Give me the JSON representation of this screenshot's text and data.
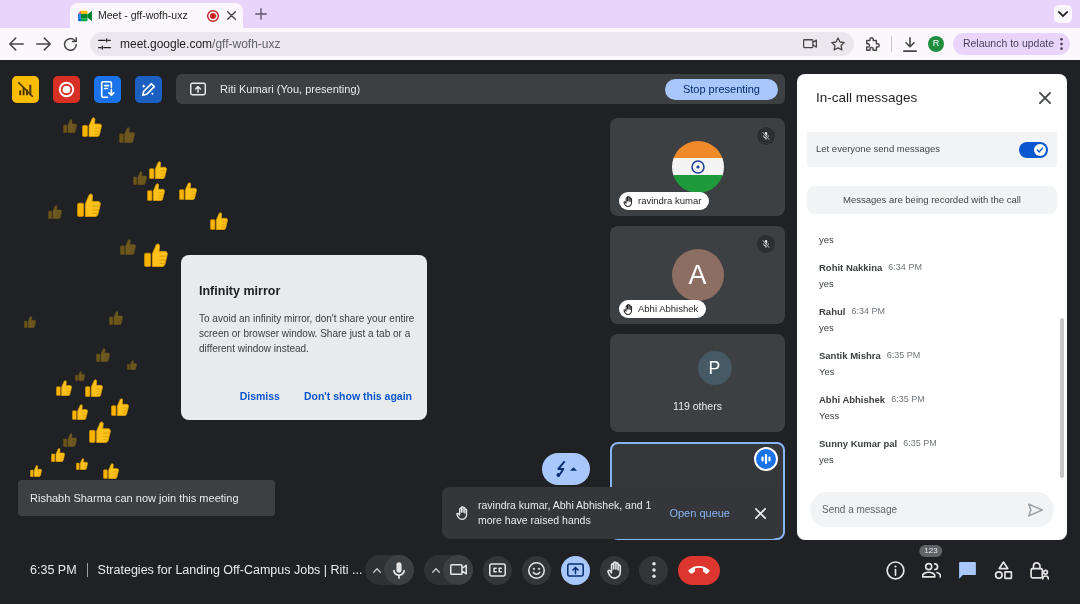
{
  "browser": {
    "tabs": [
      {
        "title": "Meet - gff-wofh-uxz",
        "selected": true,
        "recording": true
      }
    ],
    "address": {
      "host": "meet.google.com",
      "path": "/gff-wofh-uxz"
    },
    "profile_initial": "R",
    "update_button": "Relaunch to update"
  },
  "indicators": [
    {
      "kind": "slashed_chart"
    },
    {
      "kind": "record"
    },
    {
      "kind": "transcript"
    },
    {
      "kind": "notes"
    }
  ],
  "presenting_bar": {
    "label": "Riti Kumari (You, presenting)",
    "button": "Stop presenting"
  },
  "tiles": [
    {
      "kind": "participant",
      "name": "ravindra kumar",
      "avatar": {
        "kind": "flag"
      },
      "muted": true,
      "hand_raised": true,
      "speaking": false
    },
    {
      "kind": "participant",
      "name": "Abhi Abhishek",
      "avatar": {
        "kind": "letter",
        "letter": "A",
        "color": "#8d6e63"
      },
      "muted": true,
      "hand_raised": true,
      "speaking": false
    },
    {
      "kind": "others",
      "avatar": {
        "kind": "letter",
        "letter": "P",
        "color": "#455a64"
      },
      "label": "119 others",
      "speaking": false
    },
    {
      "kind": "self",
      "speaking": true
    }
  ],
  "reactions": {
    "kind": "thumbs_up"
  },
  "dialog": {
    "title": "Infinity mirror",
    "body": "To avoid an infinity mirror, don't share your entire screen or browser window. Share just a tab or a different window instead.",
    "buttons": [
      "Dismiss",
      "Don't show this again"
    ]
  },
  "notifications": [
    {
      "kind": "join",
      "text": "Rishabh Sharma can now join this meeting"
    },
    {
      "kind": "raised_hands",
      "text": "ravindra kumar, Abhi Abhishek, and 1 more have raised hands",
      "action": "Open queue"
    }
  ],
  "chat": {
    "title": "In-call messages",
    "setting": {
      "label": "Let everyone send messages",
      "on": true
    },
    "notice": "Messages are being recorded with the call",
    "messages": [
      {
        "text": "yes"
      },
      {
        "sender": "Rohit Nakkina",
        "time": "6:34 PM",
        "text": "yes"
      },
      {
        "sender": "Rahul",
        "time": "6:34 PM",
        "text": "yes"
      },
      {
        "sender": "Santik Mishra",
        "time": "6:35 PM",
        "text": "Yes"
      },
      {
        "sender": "Abhi Abhishek",
        "time": "6:35 PM",
        "text": "Yess"
      },
      {
        "sender": "Sunny Kumar pal",
        "time": "6:35 PM",
        "text": "yes"
      }
    ],
    "input": {
      "placeholder": "Send a message"
    }
  },
  "bottom_bar": {
    "time": "6:35 PM",
    "title": "Strategies for Landing Off-Campus Jobs | Riti ...",
    "controls": [
      {
        "kind": "mic",
        "active": false
      },
      {
        "kind": "camera",
        "active": false
      },
      {
        "kind": "captions",
        "active": false
      },
      {
        "kind": "emoji",
        "active": false
      },
      {
        "kind": "present",
        "active": true
      },
      {
        "kind": "raise_hand",
        "active": false
      },
      {
        "kind": "more",
        "active": false
      },
      {
        "kind": "end_call",
        "active": false
      }
    ],
    "panels": [
      {
        "kind": "info",
        "selected": false
      },
      {
        "kind": "people",
        "badge": "123",
        "selected": false
      },
      {
        "kind": "chat",
        "selected": true
      },
      {
        "kind": "activities",
        "selected": false
      },
      {
        "kind": "host_controls",
        "selected": false
      }
    ]
  }
}
